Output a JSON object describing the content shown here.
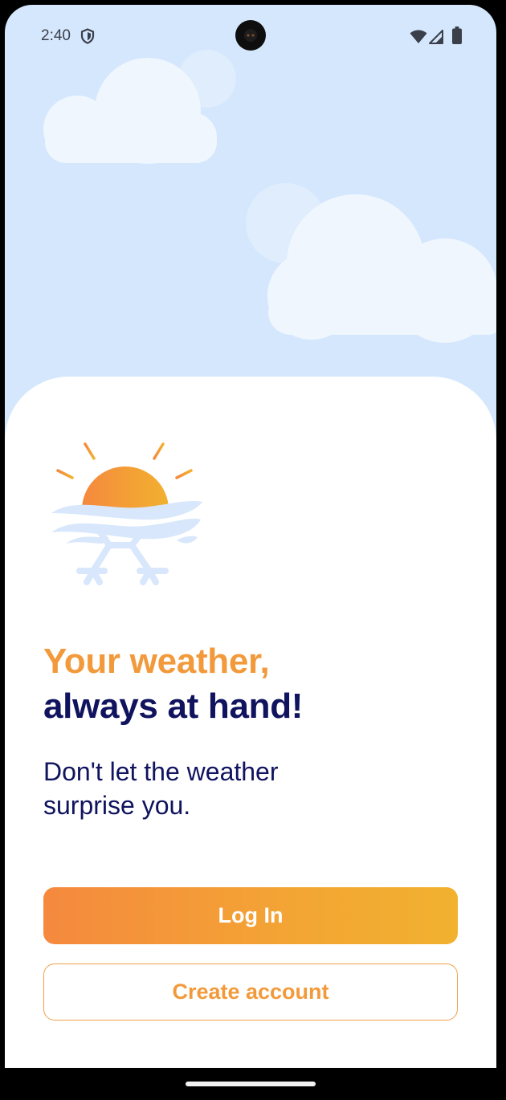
{
  "status_bar": {
    "time": "2:40",
    "icons": [
      "shield-icon",
      "wifi-icon",
      "signal-icon",
      "battery-icon"
    ]
  },
  "welcome": {
    "headline_line1": "Your weather,",
    "headline_line2": "always at hand!",
    "subtitle": "Don't let the weather surprise you."
  },
  "actions": {
    "login_label": "Log In",
    "create_account_label": "Create account"
  },
  "colors": {
    "sky": "#d5e7fd",
    "accent_orange": "#f29a3b",
    "navy": "#10135e",
    "login_gradient_start": "#f5893e",
    "login_gradient_end": "#f2b12f"
  }
}
